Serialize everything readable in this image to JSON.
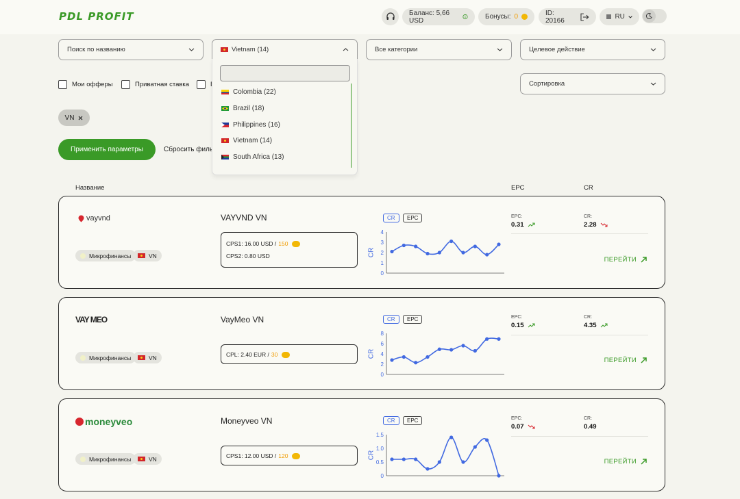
{
  "header": {
    "logo": "PDL PROFIT",
    "balance": "Баланс: 5,66 USD",
    "bonus_label": "Бонусы:",
    "bonus_value": "0",
    "user_id": "ID: 20166",
    "lang": "RU"
  },
  "filters": {
    "search_placeholder": "Поиск по названию",
    "country_selected": "Vietnam (14)",
    "categories": "Все категории",
    "target_action": "Целевое действие",
    "sorting": "Сортировка",
    "my_offers": "Мои офферы",
    "private_rate": "Приватная ставка",
    "third_checkbox": "Б",
    "chip": "VN",
    "apply": "Применить параметры",
    "reset": "Сбросить фильтр"
  },
  "dropdown": {
    "items": [
      {
        "label": "Colombia (22)",
        "flag": "co"
      },
      {
        "label": "Brazil (18)",
        "flag": "br"
      },
      {
        "label": "Philippines (16)",
        "flag": "ph"
      },
      {
        "label": "Vietnam (14)",
        "flag": "vn"
      },
      {
        "label": "South Africa (13)",
        "flag": "za"
      }
    ]
  },
  "table": {
    "col_name": "Название",
    "col_epc": "EPC",
    "col_cr": "CR"
  },
  "offers": [
    {
      "brand": "vayvnd",
      "title": "VAYVND VN",
      "category": "Микрофинансы",
      "geo": "VN",
      "payouts": [
        {
          "text": "CPS1: 16.00 USD / ",
          "bonus": "150"
        },
        {
          "text": "CPS2: 0.80 USD",
          "bonus": ""
        }
      ],
      "tab_cr": "CR",
      "tab_epc": "EPC",
      "chart_ylabel": "CR",
      "chart_yticks": [
        "4",
        "3",
        "2",
        "1",
        "0"
      ],
      "epc_label": "EPC:",
      "epc_value": "0.31",
      "epc_trend": "up",
      "cr_label": "CR:",
      "cr_value": "2.28",
      "cr_trend": "down",
      "go": "ПЕРЕЙТИ"
    },
    {
      "brand": "VAY MEO",
      "title": "VayMeo VN",
      "category": "Микрофинансы",
      "geo": "VN",
      "payouts": [
        {
          "text": "CPL: 2.40 EUR / ",
          "bonus": "30"
        }
      ],
      "tab_cr": "CR",
      "tab_epc": "EPC",
      "chart_ylabel": "CR",
      "chart_yticks": [
        "8",
        "6",
        "4",
        "2",
        "0"
      ],
      "epc_label": "EPC:",
      "epc_value": "0.15",
      "epc_trend": "up",
      "cr_label": "CR:",
      "cr_value": "4.35",
      "cr_trend": "up",
      "go": "ПЕРЕЙТИ"
    },
    {
      "brand": "moneyveo",
      "title": "Moneyveo VN",
      "category": "Микрофинансы",
      "geo": "VN",
      "payouts": [
        {
          "text": "CPS1: 12.00 USD / ",
          "bonus": "120"
        }
      ],
      "tab_cr": "CR",
      "tab_epc": "EPC",
      "chart_ylabel": "CR",
      "chart_yticks": [
        "1.5",
        "1.0",
        "0.5",
        "0"
      ],
      "epc_label": "EPC:",
      "epc_value": "0.07",
      "epc_trend": "down",
      "cr_label": "CR:",
      "cr_value": "0.49",
      "cr_trend": "none",
      "go": "ПЕРЕЙТИ"
    }
  ],
  "chart_data": [
    {
      "type": "line",
      "ylabel": "CR",
      "ylim": [
        0,
        4
      ],
      "y": [
        2.1,
        2.7,
        2.6,
        1.9,
        2.0,
        3.1,
        2.0,
        2.6,
        1.8,
        2.8
      ]
    },
    {
      "type": "line",
      "ylabel": "CR",
      "ylim": [
        0,
        8
      ],
      "y": [
        2.8,
        3.4,
        2.3,
        3.4,
        4.9,
        4.8,
        5.6,
        4.6,
        6.9,
        6.9
      ]
    },
    {
      "type": "line",
      "ylabel": "CR",
      "ylim": [
        0,
        1.5
      ],
      "y": [
        0.6,
        0.6,
        0.6,
        0.25,
        0.5,
        1.4,
        0.5,
        1.05,
        1.3,
        0.0
      ]
    }
  ],
  "colors": {
    "brand_green": "#3a9a27",
    "chart_blue": "#4169e1",
    "bonus_orange": "#f09b00"
  }
}
